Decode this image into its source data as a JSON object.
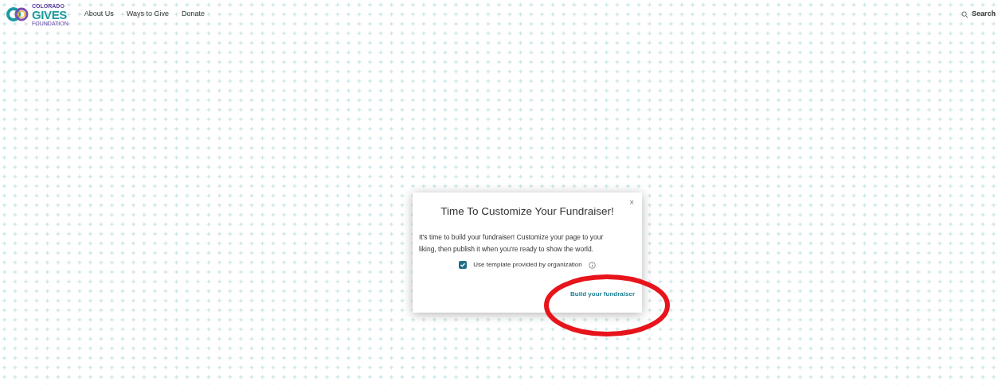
{
  "header": {
    "logo": {
      "top": "COLORADO",
      "main": "GIVES",
      "bottom": "FOUNDATION"
    },
    "nav": [
      "About Us",
      "Ways to Give",
      "Donate"
    ],
    "search": {
      "label": "Search"
    }
  },
  "modal": {
    "title": "Time To Customize Your Fundraiser!",
    "close": "×",
    "body": "It's time to build your fundraiser! Customize your page to your liking, then publish it when you're ready to show the world.",
    "checkbox": {
      "label": "Use template provided by organization",
      "checked": true
    },
    "action": "Build your fundraiser"
  }
}
